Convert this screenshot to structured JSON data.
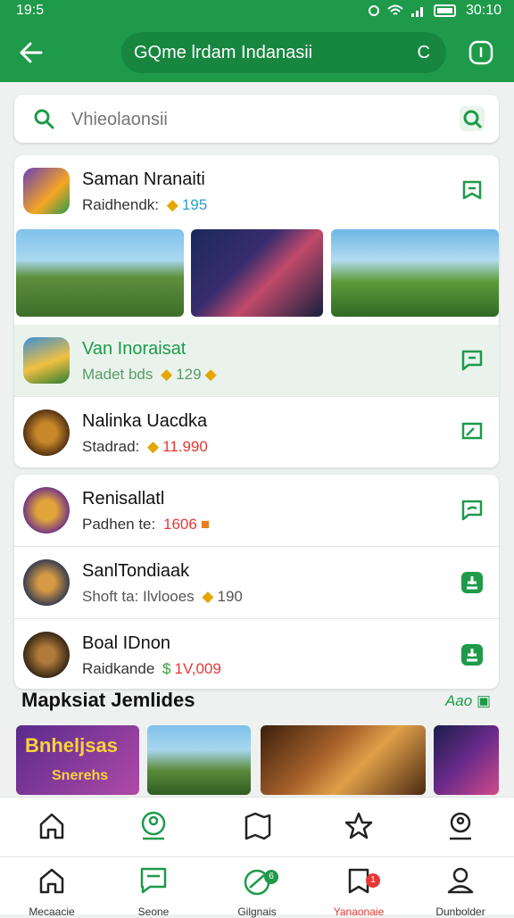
{
  "status": {
    "time": "19:5",
    "clock": "30:10"
  },
  "header": {
    "title": "GQme lrdam Indanasii",
    "refresh_glyph": "C"
  },
  "search": {
    "placeholder": "Vhieolaonsii"
  },
  "featured": {
    "name": "Saman Nranaiti",
    "sub": "Raidhendk:",
    "value": "195"
  },
  "list1": [
    {
      "name": "Van Inoraisat",
      "sub": "Madet bds",
      "value": "129",
      "icon": "comment-icon"
    },
    {
      "name": "Nalinka Uacdka",
      "sub": "Stadrad:",
      "value": "11.990",
      "icon": "comment-icon"
    }
  ],
  "list2": [
    {
      "name": "Renisallatl",
      "sub": "Padhen te:",
      "value": "1606",
      "icon": "comment-icon"
    },
    {
      "name": "SanlTondiaak",
      "sub": "Shoft ta: Ilvlooes",
      "value": "190",
      "icon": "download-icon"
    },
    {
      "name": "Boal IDnon",
      "sub": "Raidkande",
      "value": "1V,009",
      "icon": "download-icon"
    }
  ],
  "section": {
    "title": "Mapksiat Jemlides",
    "link": "Aao"
  },
  "thumb_text": {
    "first": "Bnheljsas",
    "second": "Snerehs"
  },
  "bottom_nav_labels": [
    "Mecaacie",
    "Seone",
    "Gilgnais",
    "Yanaonaie",
    "Dunbolder"
  ],
  "badges": {
    "games": "6",
    "alerts": "1"
  },
  "colors": {
    "primary": "#1e9a4a",
    "accent_red": "#e53935",
    "value_gold": "#e6a600"
  }
}
